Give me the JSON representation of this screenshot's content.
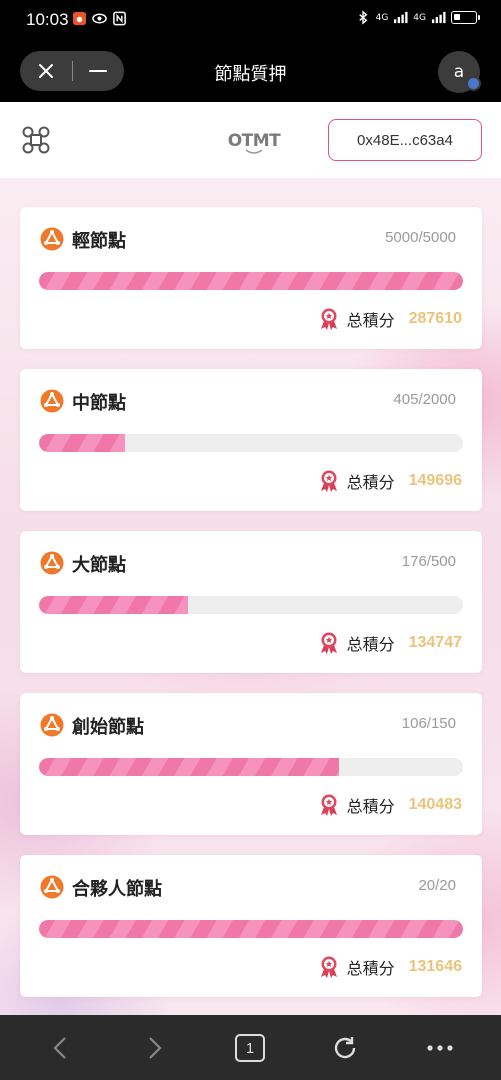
{
  "status": {
    "time": "10:03",
    "network_1": "4G",
    "network_2": "4G"
  },
  "header": {
    "title": "節點質押",
    "avatar_letter": "a"
  },
  "top": {
    "logo_text": "OTMT",
    "wallet_address": "0x48E...c63a4"
  },
  "points_label": "总積分",
  "nodes": [
    {
      "name": "輕節點",
      "count": "5000/5000",
      "progress": 1.0,
      "points": "287610"
    },
    {
      "name": "中節點",
      "count": "405/2000",
      "progress": 0.2025,
      "points": "149696"
    },
    {
      "name": "大節點",
      "count": "176/500",
      "progress": 0.352,
      "points": "134747"
    },
    {
      "name": "創始節點",
      "count": "106/150",
      "progress": 0.7067,
      "points": "140483"
    },
    {
      "name": "合夥人節點",
      "count": "20/20",
      "progress": 1.0,
      "points": "131646"
    }
  ],
  "bottom_nav": {
    "tab_count": "1",
    "icons": [
      "back-icon",
      "forward-icon",
      "tabs-icon",
      "refresh-icon",
      "more-icon"
    ]
  },
  "colors": {
    "accent_pink": "#e0557f",
    "progress_pink": "#f078a8",
    "points_gold": "#ebc37a",
    "node_icon_orange": "#f0782a"
  }
}
